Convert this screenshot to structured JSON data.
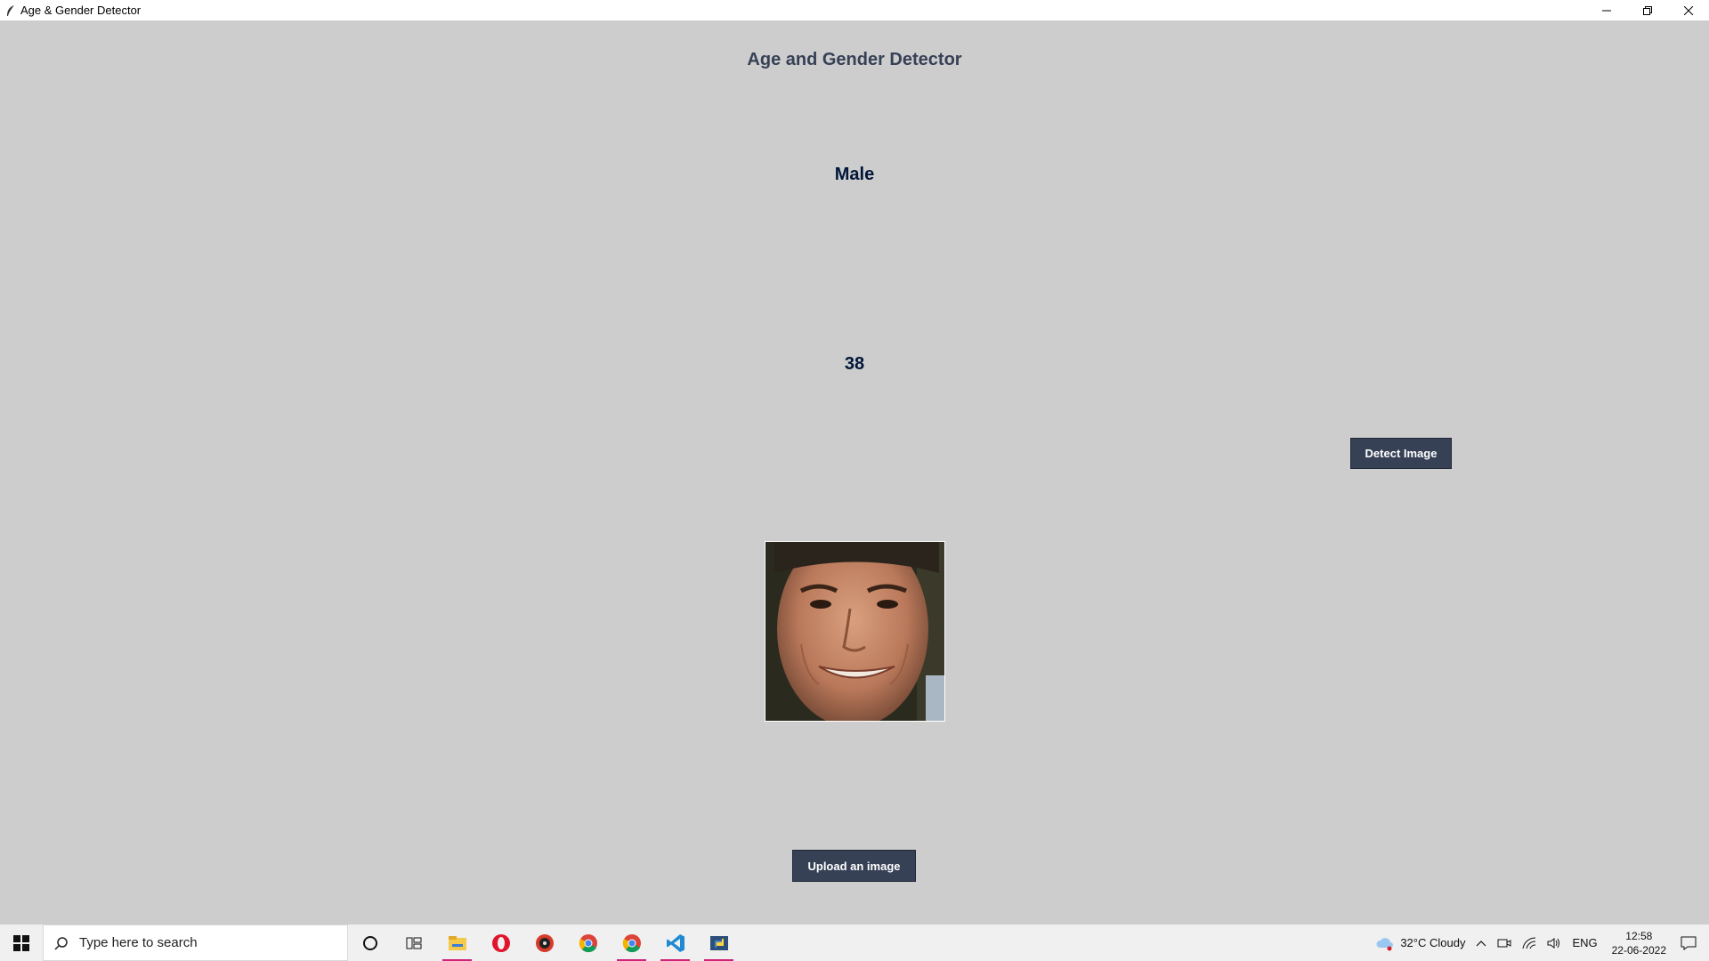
{
  "window": {
    "title": "Age & Gender Detector"
  },
  "app": {
    "heading": "Age and Gender Detector",
    "gender_result": "Male",
    "age_result": "38",
    "detect_button": "Detect Image",
    "upload_button": "Upload an image"
  },
  "taskbar": {
    "search_placeholder": "Type here to search",
    "pinned": [
      "cortana-icon",
      "task-view-icon",
      "file-explorer-icon",
      "opera-icon",
      "music-player-icon",
      "chrome-icon",
      "chrome-profile-icon",
      "vscode-icon",
      "python-icon"
    ],
    "weather": "32°C  Cloudy",
    "language": "ENG",
    "time": "12:58",
    "date": "22-06-2022"
  },
  "colors": {
    "background": "#cdcdcd",
    "button": "#364156",
    "heading": "#364156",
    "result_text": "#011638"
  }
}
